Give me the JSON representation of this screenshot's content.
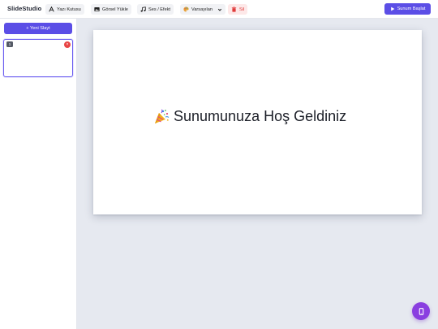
{
  "app": {
    "title": "SlideStudio"
  },
  "toolbar": {
    "textbox_label": "Yazı Kutusu",
    "upload_image_label": "Görsel Yükle",
    "audio_effect_label": "Ses / Efekt",
    "theme_select_value": "Varsayılan",
    "delete_label": "Sil",
    "present_label": "Sunum Başlat"
  },
  "sidebar": {
    "new_slide_label": "+ Yeni Slayt",
    "slides": [
      {
        "number": "1",
        "delete_symbol": "×"
      }
    ]
  },
  "slide": {
    "title": "Sunumunuza Hoş Geldiniz",
    "icon": "party-popper-icon"
  },
  "fab": {
    "icon": "mobile-device-icon"
  },
  "colors": {
    "accent": "#5b4ee6",
    "danger": "#e84545",
    "fab": "#8a3fe0",
    "canvas": "#e6e9f0"
  }
}
